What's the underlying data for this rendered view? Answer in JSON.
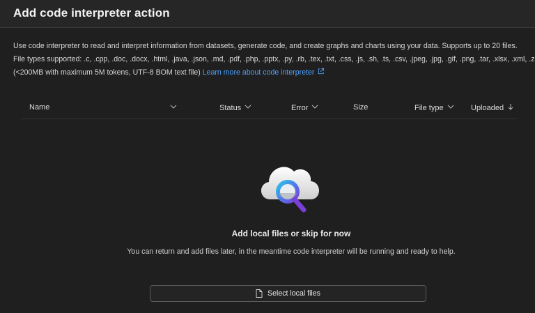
{
  "header": {
    "title": "Add code interpreter action"
  },
  "description": {
    "line1": "Use code interpreter to read and interpret information from datasets, generate code, and create graphs and charts using your data. Supports up to 20 files.",
    "line2": "File types supported: .c, .cpp, .doc, .docx, .html, .java, .json, .md, .pdf, .php, .pptx, .py, .rb, .tex, .txt, .css, .js, .sh, .ts, .csv, .jpeg, .jpg, .gif, .png, .tar, .xlsx, .xml, .zip",
    "line3": "(<200MB with maximum 5M tokens, UTF-8 BOM text file)",
    "learn_more": "Learn more about code interpreter",
    "external_icon": "external-link-icon"
  },
  "table": {
    "columns": [
      "Name",
      "Status",
      "Error",
      "Size",
      "File type",
      "Uploaded"
    ],
    "sort_icon": "arrow-down-icon",
    "filter_icon": "chevron-down-icon"
  },
  "empty_state": {
    "icon": "cloud-search-icon",
    "title": "Add local files or skip for now",
    "subtitle": "You can return and add files later, in the meantime code interpreter will be running and ready to help."
  },
  "actions": {
    "select_local_files": "Select local files",
    "select_icon": "document-icon"
  },
  "colors": {
    "background": "#1f1f1f",
    "header": "#262626",
    "link": "#4ea1ff",
    "accent_ring": "#5b4fd6"
  }
}
